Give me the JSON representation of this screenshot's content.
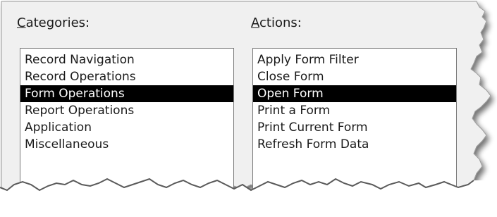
{
  "dialog": {
    "categories": {
      "label_accel": "C",
      "label_rest": "ategories:",
      "selected_index": 2,
      "items": [
        "Record Navigation",
        "Record Operations",
        "Form Operations",
        "Report Operations",
        "Application",
        "Miscellaneous"
      ]
    },
    "actions": {
      "label_accel": "A",
      "label_rest": "ctions:",
      "selected_index": 2,
      "items": [
        "Apply Form Filter",
        "Close Form",
        "Open Form",
        "Print a Form",
        "Print Current Form",
        "Refresh Form Data"
      ]
    }
  },
  "colors": {
    "panel_background": "#f0f0f0",
    "selection_background": "#000000",
    "selection_text": "#ffffff",
    "list_border": "#7a7a7a"
  }
}
